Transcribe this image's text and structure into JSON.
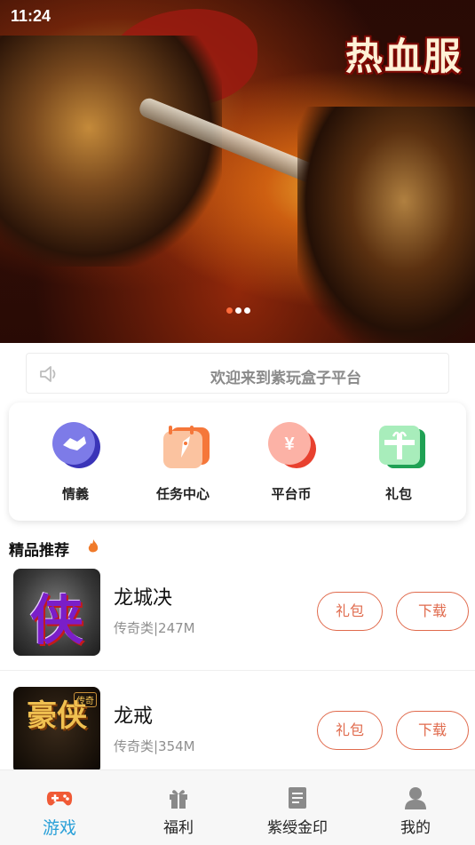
{
  "status_bar": {
    "time": "11:24"
  },
  "banner": {
    "title_art": "热血服",
    "dots": 3,
    "active_dot": 0
  },
  "notice": {
    "text": "欢迎来到紫玩盒子平台"
  },
  "quick_menu": [
    {
      "label": "情義",
      "icon": "handshake-icon"
    },
    {
      "label": "任务中心",
      "icon": "rocket-calendar-icon"
    },
    {
      "label": "平台币",
      "icon": "yen-coin-icon"
    },
    {
      "label": "礼包",
      "icon": "gift-icon"
    }
  ],
  "section": {
    "title": "精品推荐"
  },
  "games": [
    {
      "name": "龙城决",
      "meta": "传奇类|247M",
      "thumb_text": "侠",
      "gift_label": "礼包",
      "download_label": "下载"
    },
    {
      "name": "龙戒",
      "meta": "传奇类|354M",
      "thumb_text": "豪侠",
      "thumb_badge": "传奇",
      "gift_label": "礼包",
      "download_label": "下载"
    }
  ],
  "tabs": [
    {
      "label": "游戏",
      "icon": "gamepad-icon",
      "active": true
    },
    {
      "label": "福利",
      "icon": "gift-icon",
      "active": false
    },
    {
      "label": "紫绶金印",
      "icon": "document-icon",
      "active": false
    },
    {
      "label": "我的",
      "icon": "user-icon",
      "active": false
    }
  ],
  "colors": {
    "accent": "#e06a4c",
    "tab_active": "#2aa0d8",
    "dot_active": "#ff6b3b"
  }
}
